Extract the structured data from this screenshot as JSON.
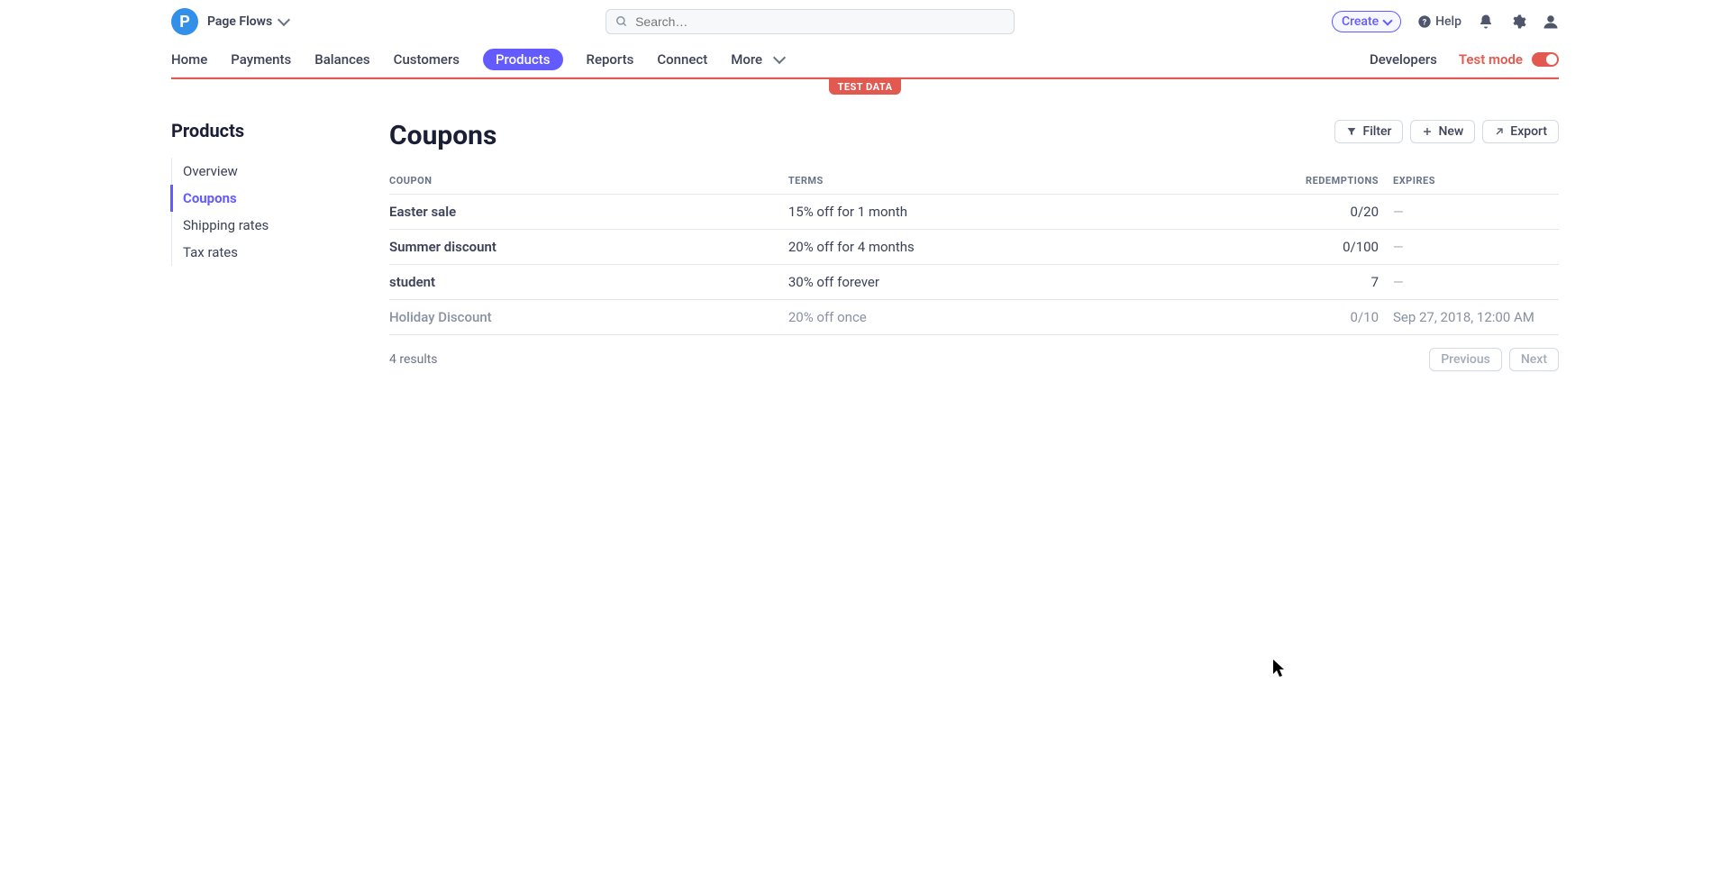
{
  "topbar": {
    "account_name": "Page Flows",
    "search_placeholder": "Search…",
    "create_label": "Create",
    "help_label": "Help"
  },
  "mainnav": {
    "items": [
      "Home",
      "Payments",
      "Balances",
      "Customers",
      "Products",
      "Reports",
      "Connect",
      "More"
    ],
    "active_index": 4,
    "developers_label": "Developers",
    "test_mode_label": "Test mode",
    "test_data_tag": "TEST DATA"
  },
  "sidebar": {
    "title": "Products",
    "items": [
      "Overview",
      "Coupons",
      "Shipping rates",
      "Tax rates"
    ],
    "active_index": 1
  },
  "main": {
    "title": "Coupons",
    "actions": {
      "filter": "Filter",
      "new": "New",
      "export": "Export"
    },
    "columns": {
      "coupon": "COUPON",
      "terms": "TERMS",
      "redemptions": "REDEMPTIONS",
      "expires": "EXPIRES"
    },
    "rows": [
      {
        "name": "Easter sale",
        "terms": "15% off for 1 month",
        "redemptions": "0/20",
        "expires": "—",
        "muted": false
      },
      {
        "name": "Summer discount",
        "terms": "20% off for 4 months",
        "redemptions": "0/100",
        "expires": "—",
        "muted": false
      },
      {
        "name": "student",
        "terms": "30% off forever",
        "redemptions": "7",
        "expires": "—",
        "muted": false
      },
      {
        "name": "Holiday Discount",
        "terms": "20% off once",
        "redemptions": "0/10",
        "expires": "Sep 27, 2018, 12:00 AM",
        "muted": true
      }
    ],
    "results_label": "4 results",
    "previous_label": "Previous",
    "next_label": "Next"
  }
}
